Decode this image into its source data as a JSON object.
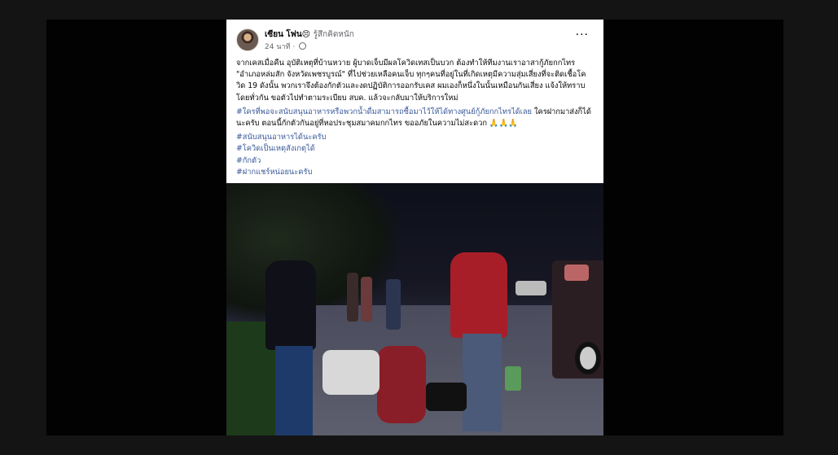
{
  "post": {
    "author_name": "เซียน โฟน",
    "author_emoji": "😣",
    "feeling": "รู้สึกคิดหนัก",
    "time": "24 นาที ·",
    "more_label": "···",
    "paragraph1": "จากเคสเมื่อคืน อุบัติเหตุที่บ้านหวาย ผู้บาดเจ็บมีผลโควิดเทสเป็นบวก ต้องทำให้ทีมงานเราอาสากู้ภัยกกไทร \"อำเภอหล่มสัก จังหวัดเพชรบูรณ์\" ที่ไปช่วยเหลือคนเจ็บ ทุกๆคนที่อยู่ในที่เกิดเหตุมีความสุ่มเสี่ยงที่จะติดเชื้อโควิด 19 ดังนั้น พวกเราจึงต้องกักตัวและงดปฏิบัติการออกรับเคส ผมเองก็หนึ่งในนั้นเหมือนกันเสี่ยง แจ้งให้ทราบโดยทั่วกัน ขอตัวไปทำตามระเบียบ สบค. แล้วจะกลับมาให้บริการใหม่",
    "paragraph2_hashtag": "#ใครที่พอจะสนับสนุนอาหารหรือพวกน้ำดื่มสามารถซื้อมาไว้ให้ได้ทางศูนย์กู้ภัยกกไทรได้เลย",
    "paragraph2_text": " ใครฝากมาส่งก็ได้นะครับ ตอนนี้กักตัวกันอยู่ที่หอประชุมสมาคมกกไทร ขออภัยในความไม่สะดวก 🙏🙏🙏",
    "hashtags": [
      "#สนับสนุนอาหารได้นะครับ",
      "#โควิดเป็นเหตุสังเกตุได้",
      "#กักตัว",
      "#ฝากแชร์หน่อยนะครับ"
    ],
    "photo_alt": "Night scene of rescue volunteers attending to an injured person on a road"
  },
  "colors": {
    "page_bg": "#141414",
    "card_bg": "#ffffff",
    "link": "#385898",
    "secondary_text": "#65676b"
  }
}
